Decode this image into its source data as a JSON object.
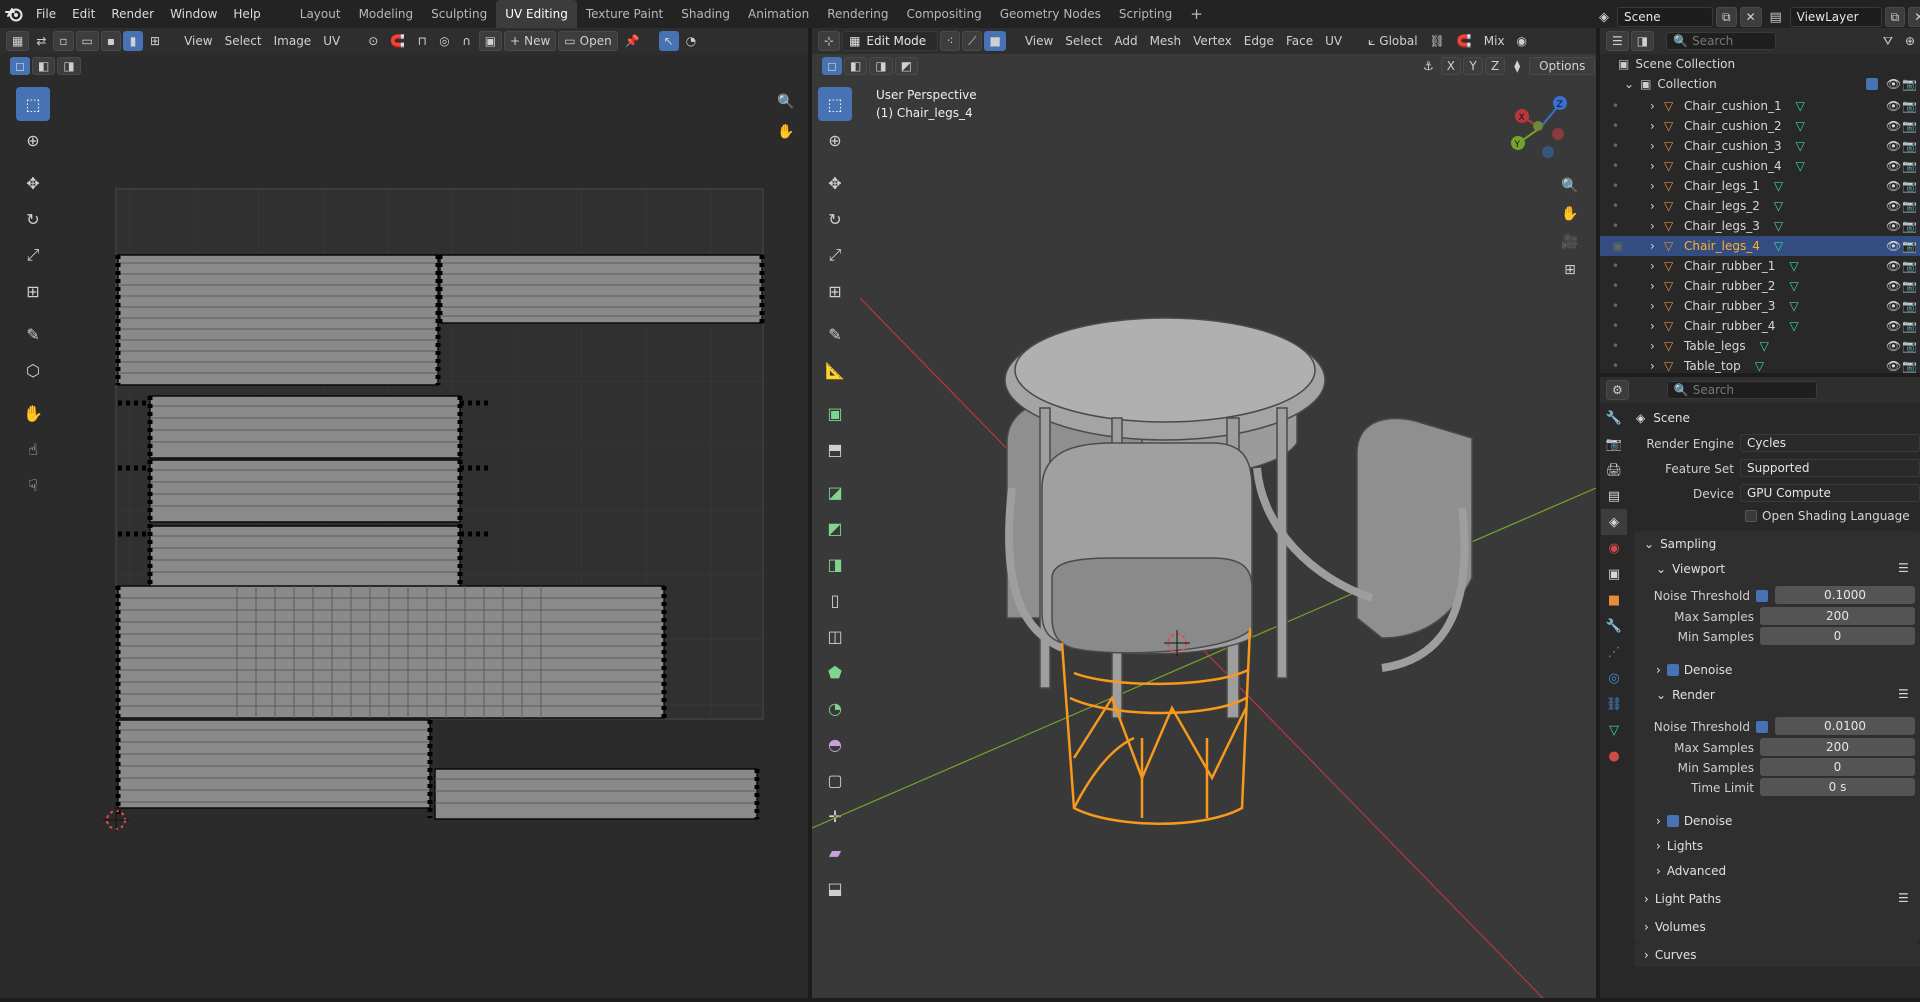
{
  "topbar": {
    "menus": [
      "File",
      "Edit",
      "Render",
      "Window",
      "Help"
    ],
    "workspaces": [
      "Layout",
      "Modeling",
      "Sculpting",
      "UV Editing",
      "Texture Paint",
      "Shading",
      "Animation",
      "Rendering",
      "Compositing",
      "Geometry Nodes",
      "Scripting"
    ],
    "active_workspace": "UV Editing",
    "add_tab": "+",
    "scene_name": "Scene",
    "view_layer": "ViewLayer"
  },
  "uv_editor": {
    "menus": [
      "View",
      "Select",
      "Image",
      "UV"
    ],
    "new_label": "New",
    "open_label": "Open"
  },
  "viewport": {
    "mode": "Edit Mode",
    "menus": [
      "View",
      "Select",
      "Add",
      "Mesh",
      "Vertex",
      "Edge",
      "Face",
      "UV"
    ],
    "orientation": "Global",
    "shading_mix": "Mix",
    "options_label": "Options",
    "axis_x": "X",
    "axis_y": "Y",
    "axis_z": "Z",
    "overlay_title": "User Perspective",
    "overlay_object": "(1) Chair_legs_4"
  },
  "outliner": {
    "search_placeholder": "Search",
    "scene_collection": "Scene Collection",
    "collection": "Collection",
    "items": [
      "Chair_cushion_1",
      "Chair_cushion_2",
      "Chair_cushion_3",
      "Chair_cushion_4",
      "Chair_legs_1",
      "Chair_legs_2",
      "Chair_legs_3",
      "Chair_legs_4",
      "Chair_rubber_1",
      "Chair_rubber_2",
      "Chair_rubber_3",
      "Chair_rubber_4",
      "Table_legs",
      "Table_top"
    ],
    "selected": "Chair_legs_4"
  },
  "properties": {
    "search_placeholder": "Search",
    "context": "Scene",
    "render_engine_label": "Render Engine",
    "render_engine": "Cycles",
    "feature_set_label": "Feature Set",
    "feature_set": "Supported",
    "device_label": "Device",
    "device": "GPU Compute",
    "osl_label": "Open Shading Language",
    "sampling": "Sampling",
    "viewport": "Viewport",
    "noise_threshold_label": "Noise Threshold",
    "viewport_noise_threshold": "0.1000",
    "max_samples_label": "Max Samples",
    "viewport_max_samples": "200",
    "min_samples_label": "Min Samples",
    "viewport_min_samples": "0",
    "denoise_label": "Denoise",
    "render": "Render",
    "render_noise_threshold": "0.0100",
    "render_max_samples": "200",
    "render_min_samples": "0",
    "time_limit_label": "Time Limit",
    "time_limit": "0 s",
    "lights": "Lights",
    "advanced": "Advanced",
    "light_paths": "Light Paths",
    "volumes": "Volumes",
    "curves": "Curves"
  },
  "colors": {
    "accent": "#4772b3",
    "selection_orange": "#f59a1c",
    "x_axis": "#b9363f",
    "y_axis": "#74a52a",
    "z_axis": "#3a6fd1",
    "mesh_icon": "#3fd6a0",
    "object_icon": "#e88b3a"
  }
}
